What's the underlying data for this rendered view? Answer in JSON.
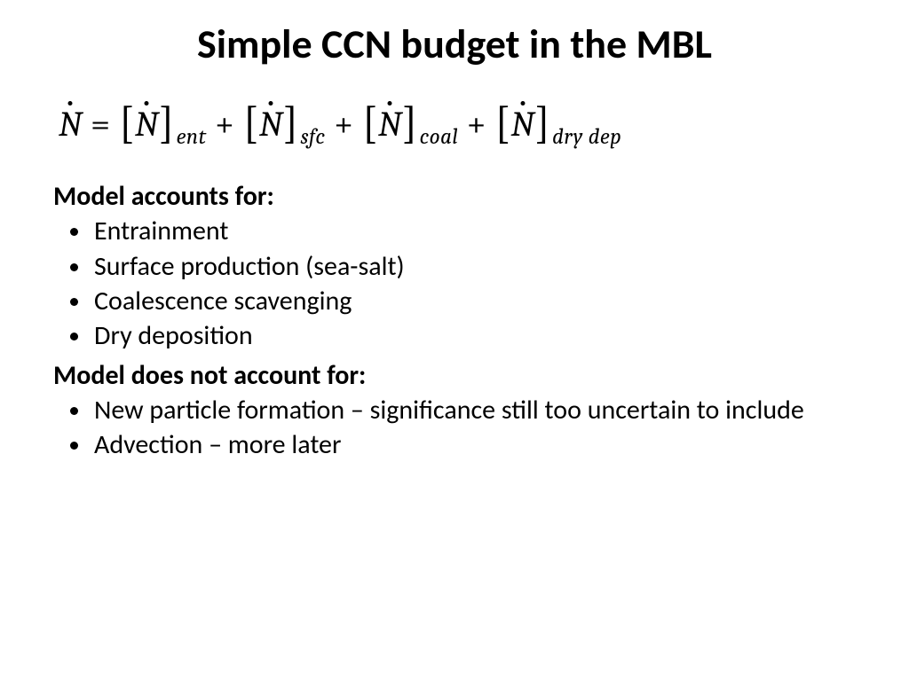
{
  "title": "Simple CCN budget in the MBL",
  "equation": {
    "lhs_var": "N",
    "terms": [
      {
        "var": "N",
        "sub": "ent"
      },
      {
        "var": "N",
        "sub": "sfc"
      },
      {
        "var": "N",
        "sub": "coal"
      },
      {
        "var": "N",
        "sub": "dry dep"
      }
    ]
  },
  "section1": {
    "heading": "Model accounts for:",
    "items": [
      "Entrainment",
      "Surface production (sea-salt)",
      "Coalescence scavenging",
      "Dry deposition"
    ]
  },
  "section2": {
    "heading": "Model does not account for:",
    "items": [
      "New particle formation – significance still too uncertain to include",
      "Advection – more later"
    ]
  }
}
